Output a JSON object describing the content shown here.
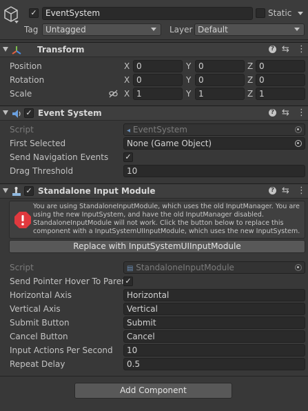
{
  "gameobject": {
    "name": "EventSystem",
    "active": true,
    "static_label": "Static",
    "static_checked": false,
    "tag_label": "Tag",
    "tag_value": "Untagged",
    "layer_label": "Layer",
    "layer_value": "Default"
  },
  "transform": {
    "title": "Transform",
    "position_label": "Position",
    "rotation_label": "Rotation",
    "scale_label": "Scale",
    "axis_x": "X",
    "axis_y": "Y",
    "axis_z": "Z",
    "position": {
      "x": "0",
      "y": "0",
      "z": "0"
    },
    "rotation": {
      "x": "0",
      "y": "0",
      "z": "0"
    },
    "scale": {
      "x": "1",
      "y": "1",
      "z": "1"
    }
  },
  "event_system": {
    "title": "Event System",
    "enabled": true,
    "script_label": "Script",
    "script_value": "EventSystem",
    "first_selected_label": "First Selected",
    "first_selected_value": "None (Game Object)",
    "send_nav_label": "Send Navigation Events",
    "send_nav_checked": true,
    "drag_threshold_label": "Drag Threshold",
    "drag_threshold_value": "10"
  },
  "input_module": {
    "title": "Standalone Input Module",
    "enabled": true,
    "warning_text": "You are using StandaloneInputModule, which uses the old InputManager. You are using the new InputSystem, and have the old InputManager disabled. StandaloneInputModule will not work. Click the button below to replace this component with a InputSystemUIInputModule, which uses the new InputSystem.",
    "replace_button": "Replace with InputSystemUIInputModule",
    "script_label": "Script",
    "script_value": "StandaloneInputModule",
    "hover_label": "Send Pointer Hover To Paren",
    "hover_checked": true,
    "horizontal_label": "Horizontal Axis",
    "horizontal_value": "Horizontal",
    "vertical_label": "Vertical Axis",
    "vertical_value": "Vertical",
    "submit_label": "Submit Button",
    "submit_value": "Submit",
    "cancel_label": "Cancel Button",
    "cancel_value": "Cancel",
    "ips_label": "Input Actions Per Second",
    "ips_value": "10",
    "repeat_label": "Repeat Delay",
    "repeat_value": "0.5"
  },
  "add_component_button": "Add Component",
  "colors": {
    "background": "#383838",
    "field": "#2a2a2a",
    "header": "#3e3e3e",
    "warning_icon": "#e0393e",
    "button": "#585858"
  },
  "icons": {
    "gameobject": "cube-icon",
    "transform": "transform-axes-icon",
    "event_system": "event-system-icon",
    "input_module": "input-module-icon",
    "warning": "error-icon",
    "help": "help-icon",
    "presets": "presets-icon",
    "menu": "kebab-menu-icon",
    "link": "link-icon",
    "picker": "object-picker-icon"
  }
}
